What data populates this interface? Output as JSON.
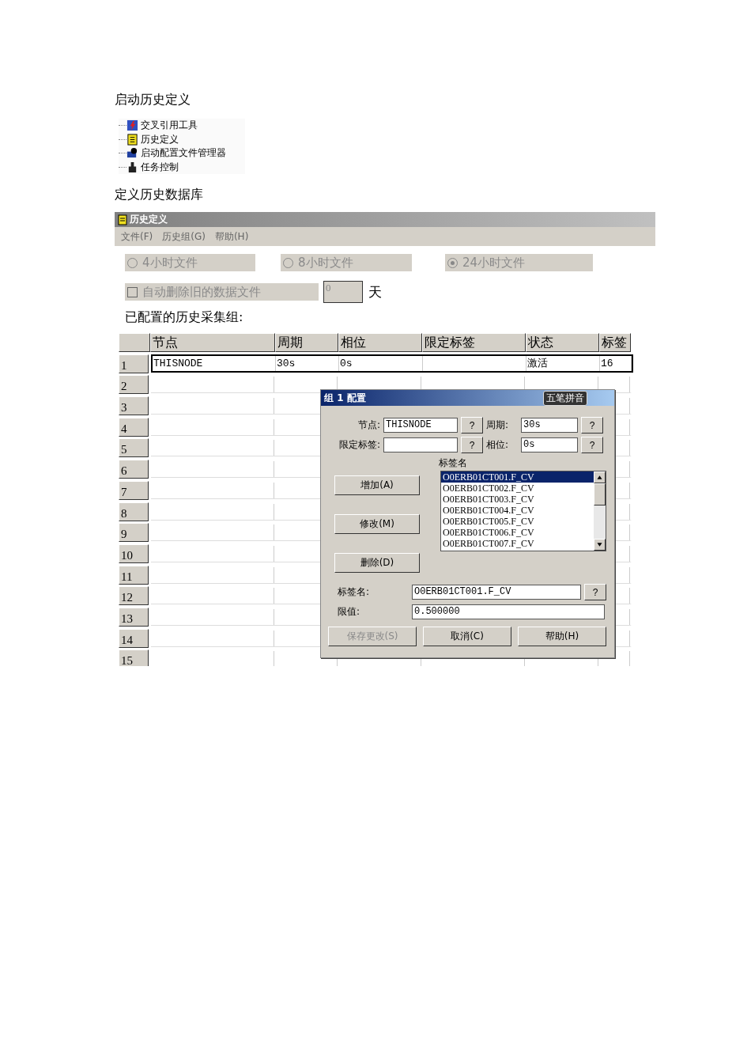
{
  "section_1": {
    "title": "启动历史定义"
  },
  "tree": {
    "items": [
      {
        "label": "交叉引用工具"
      },
      {
        "label": "历史定义"
      },
      {
        "label": "启动配置文件管理器"
      },
      {
        "label": "任务控制"
      }
    ]
  },
  "section_2": {
    "title": "定义历史数据库"
  },
  "window": {
    "title": "历史定义",
    "menu": [
      "文件(F)",
      "历史组(G)",
      "帮助(H)"
    ],
    "file_options": [
      {
        "label": "4小时文件",
        "selected": false,
        "disabled": true
      },
      {
        "label": "8小时文件",
        "selected": false,
        "disabled": true
      },
      {
        "label": "24小时文件",
        "selected": true,
        "disabled": true
      }
    ],
    "auto_delete": {
      "label": "自动删除旧的数据文件",
      "checked": false,
      "disabled": true,
      "days": "0",
      "unit": "天"
    },
    "groups_label": "已配置的历史采集组:",
    "grid": {
      "columns": [
        "节点",
        "周期",
        "相位",
        "限定标签",
        "状态",
        "标签"
      ],
      "rows": [
        {
          "number": "1",
          "selected": true,
          "node": "THISNODE",
          "period": "30s",
          "phase": "0s",
          "status": "激活",
          "tags": "16"
        },
        {
          "number": "2",
          "selected": false
        },
        {
          "number": "3",
          "selected": false
        },
        {
          "number": "4",
          "selected": false
        },
        {
          "number": "5",
          "selected": false
        },
        {
          "number": "6",
          "selected": false
        },
        {
          "number": "7",
          "selected": false
        },
        {
          "number": "8",
          "selected": false
        },
        {
          "number": "9",
          "selected": false
        },
        {
          "number": "10",
          "selected": false
        },
        {
          "number": "11",
          "selected": false
        },
        {
          "number": "12",
          "selected": false
        },
        {
          "number": "13",
          "selected": false
        },
        {
          "number": "14",
          "selected": false
        },
        {
          "number": "15",
          "selected": false
        }
      ]
    }
  },
  "dialog": {
    "title": "组 1 配置",
    "ime_bar": "五笔拼音",
    "node": {
      "label": "节点:",
      "value": "THISNODE",
      "help": "?"
    },
    "period": {
      "label": "周期:",
      "value": "30s",
      "help": "?"
    },
    "limit_tag": {
      "label": "限定标签:",
      "help": "?"
    },
    "phase": {
      "label": "相位:",
      "value": "0s",
      "help": "?"
    },
    "tag_list_label": "标签名",
    "actions": [
      {
        "label": "增加(A)"
      },
      {
        "label": "修改(M)"
      },
      {
        "label": "删除(D)"
      }
    ],
    "tags": [
      {
        "name": "O0ERB01CT001.F_CV",
        "selected": true
      },
      {
        "name": "O0ERB01CT002.F_CV",
        "selected": false
      },
      {
        "name": "O0ERB01CT003.F_CV",
        "selected": false
      },
      {
        "name": "O0ERB01CT004.F_CV",
        "selected": false
      },
      {
        "name": "O0ERB01CT005.F_CV",
        "selected": false
      },
      {
        "name": "O0ERB01CT006.F_CV",
        "selected": false
      },
      {
        "name": "O0ERB01CT007.F_CV",
        "selected": false
      }
    ],
    "tag_name": {
      "label": "标签名:",
      "value": "O0ERB01CT001.F_CV",
      "help": "?"
    },
    "limit": {
      "label": "限值:",
      "value": "0.500000"
    },
    "buttons": [
      {
        "label": "保存更改(S)",
        "disabled": true
      },
      {
        "label": "取消(C)",
        "disabled": false
      },
      {
        "label": "帮助(H)",
        "disabled": false
      }
    ]
  }
}
